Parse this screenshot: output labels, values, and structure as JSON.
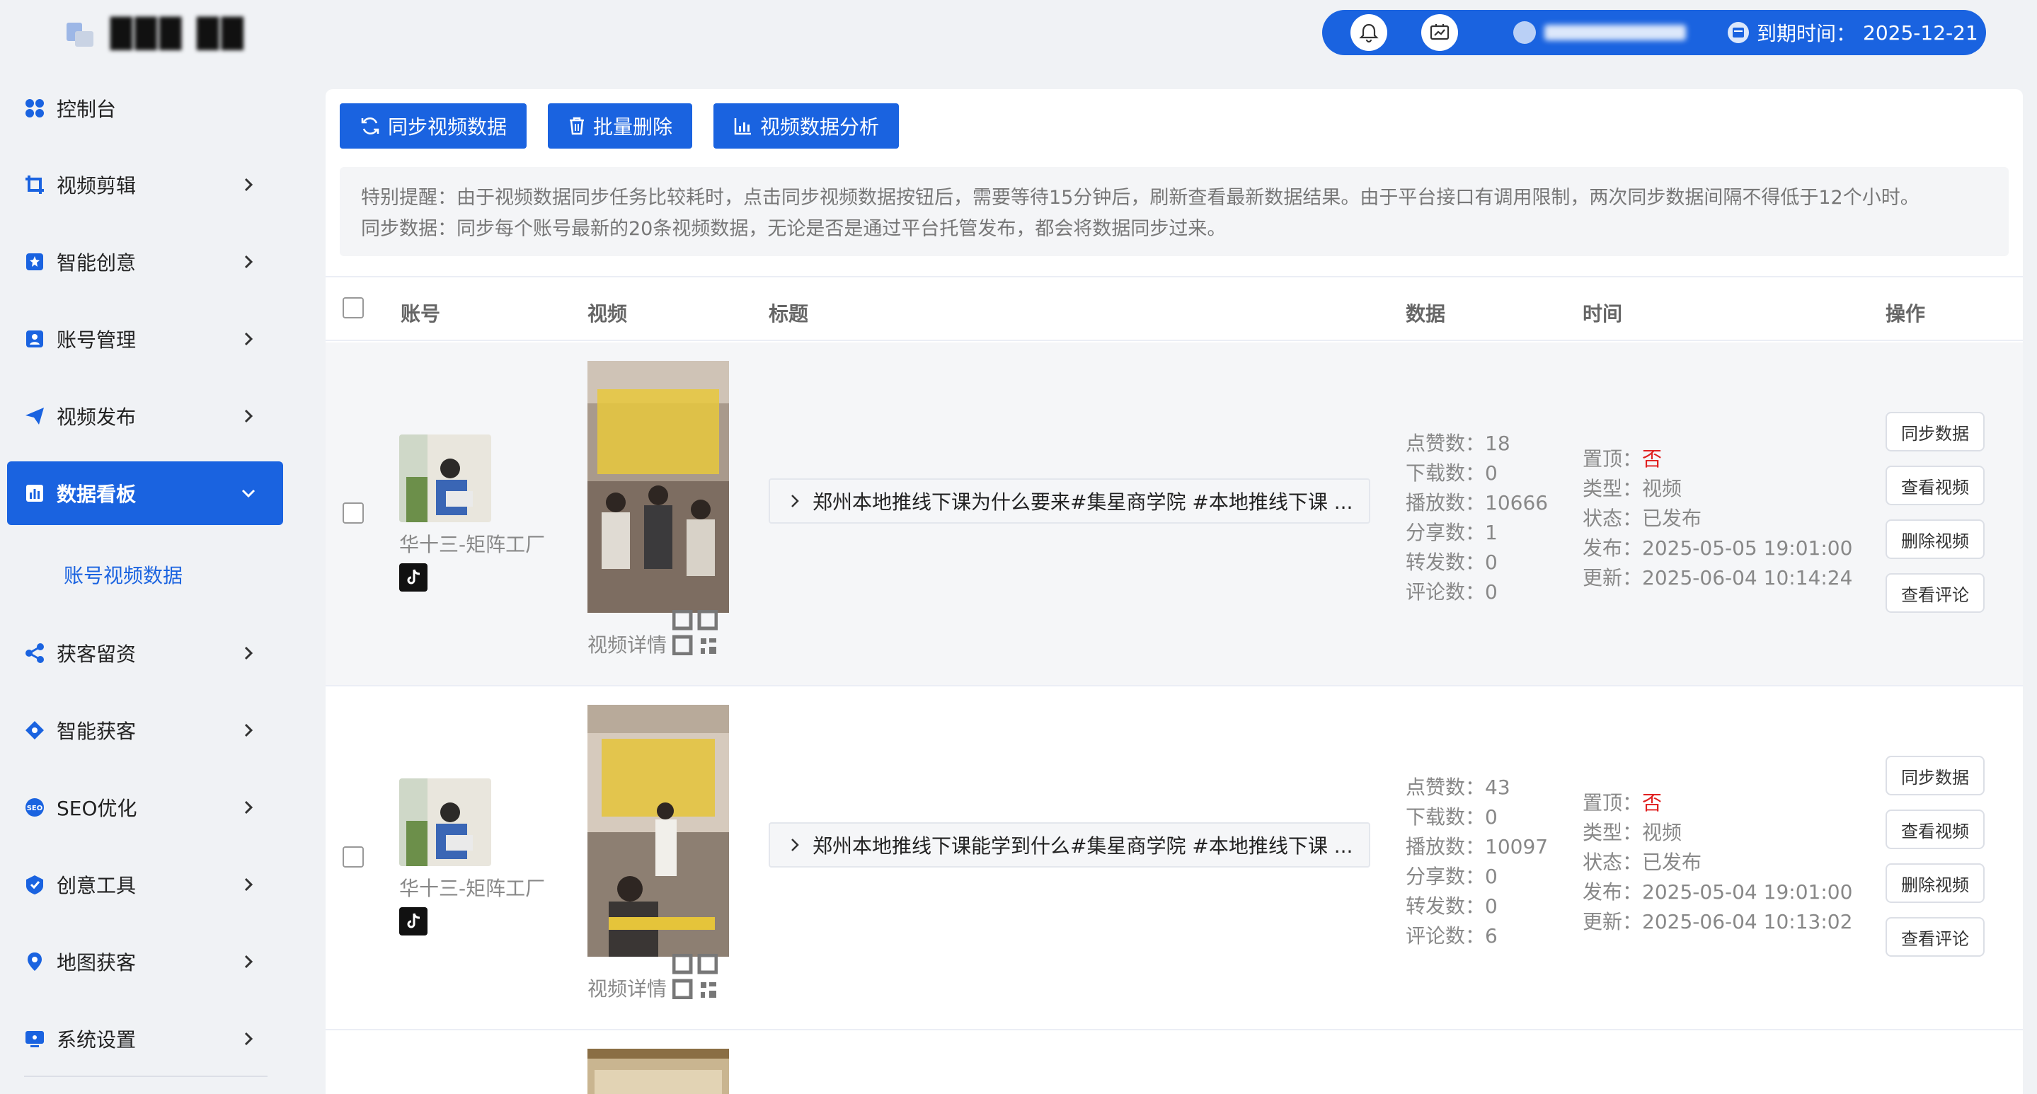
{
  "brand": {
    "logo_text": "███ ██"
  },
  "sidebar": {
    "items": [
      {
        "label": "控制台",
        "icon": "dashboard-icon"
      },
      {
        "label": "视频剪辑",
        "icon": "crop-icon"
      },
      {
        "label": "智能创意",
        "icon": "magic-icon"
      },
      {
        "label": "账号管理",
        "icon": "account-icon"
      },
      {
        "label": "视频发布",
        "icon": "send-icon"
      },
      {
        "label": "数据看板",
        "icon": "chart-icon"
      },
      {
        "label": "获客留资",
        "icon": "share-icon"
      },
      {
        "label": "智能获客",
        "icon": "target-icon"
      },
      {
        "label": "SEO优化",
        "icon": "seo-icon"
      },
      {
        "label": "创意工具",
        "icon": "shield-icon"
      },
      {
        "label": "地图获客",
        "icon": "map-pin-icon"
      },
      {
        "label": "系统设置",
        "icon": "monitor-icon"
      }
    ],
    "active_index": 5,
    "sub_items": [
      {
        "label": "账号视频数据"
      }
    ]
  },
  "topbar": {
    "expire_label": "到期时间：",
    "expire_date": "2025-12-21"
  },
  "toolbar": {
    "sync_label": "同步视频数据",
    "batch_delete_label": "批量删除",
    "analysis_label": "视频数据分析"
  },
  "notice": {
    "line1": "特别提醒：由于视频数据同步任务比较耗时，点击同步视频数据按钮后，需要等待15分钟后，刷新查看最新数据结果。由于平台接口有调用限制，两次同步数据间隔不得低于12个小时。",
    "line2": "同步数据：同步每个账号最新的20条视频数据，无论是否是通过平台托管发布，都会将数据同步过来。"
  },
  "table": {
    "headers": {
      "account": "账号",
      "video": "视频",
      "title": "标题",
      "data": "数据",
      "time": "时间",
      "ops": "操作"
    },
    "stat_labels": {
      "likes": "点赞数：",
      "downloads": "下载数：",
      "plays": "播放数：",
      "shares": "分享数：",
      "forwards": "转发数：",
      "comments": "评论数："
    },
    "time_labels": {
      "pinned": "置顶：",
      "type": "类型：",
      "status": "状态：",
      "published": "发布：",
      "updated": "更新："
    },
    "op_labels": {
      "sync": "同步数据",
      "view": "查看视频",
      "delete": "删除视频",
      "comments": "查看评论"
    },
    "detail_label": "视频详情",
    "rows": [
      {
        "account": "华十三-矩阵工厂",
        "title": "郑州本地推线下课为什么要来#集星商学院 #本地推线下课 ...",
        "likes": "18",
        "downloads": "0",
        "plays": "10666",
        "shares": "1",
        "forwards": "0",
        "comments": "0",
        "pinned": "否",
        "type": "视频",
        "status": "已发布",
        "published": "2025-05-05 19:01:00",
        "updated": "2025-06-04 10:14:24"
      },
      {
        "account": "华十三-矩阵工厂",
        "title": "郑州本地推线下课能学到什么#集星商学院 #本地推线下课 ...",
        "likes": "43",
        "downloads": "0",
        "plays": "10097",
        "shares": "0",
        "forwards": "0",
        "comments": "6",
        "pinned": "否",
        "type": "视频",
        "status": "已发布",
        "published": "2025-05-04 19:01:00",
        "updated": "2025-06-04 10:13:02"
      }
    ]
  },
  "colors": {
    "primary": "#1a63e0",
    "danger": "#e02020",
    "muted": "#888888"
  }
}
